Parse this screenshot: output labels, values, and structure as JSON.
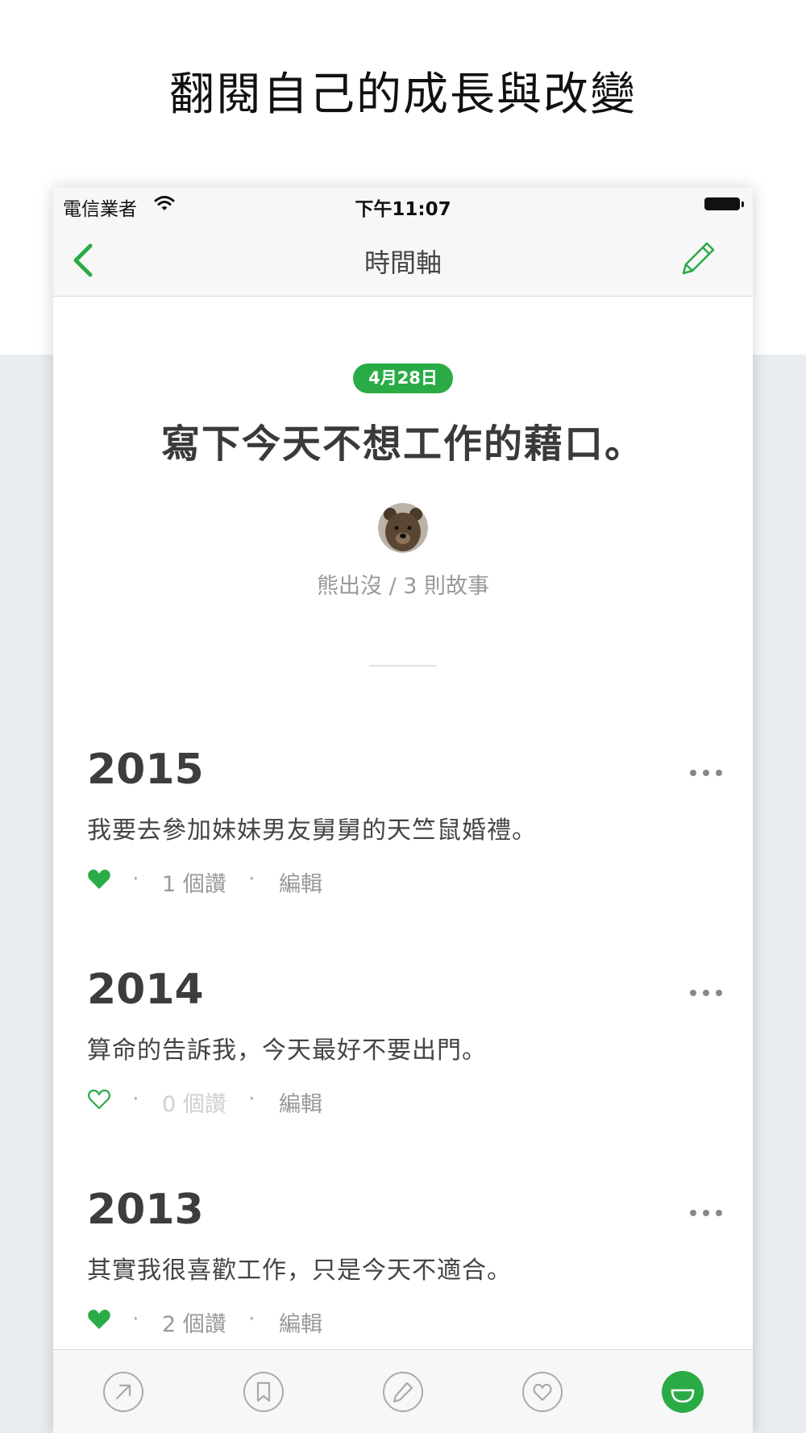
{
  "headline": "翻閱自己的成長與改變",
  "status_bar": {
    "carrier": "電信業者",
    "time": "下午11:07"
  },
  "nav": {
    "title": "時間軸",
    "back_icon": "chevron-left-icon",
    "compose_icon": "pencil-icon"
  },
  "question": {
    "date": "4月28日",
    "text": "寫下今天不想工作的藉口。",
    "author_line": "熊出沒 / 3 則故事"
  },
  "entries": [
    {
      "year": "2015",
      "text": "我要去參加妹妹男友舅舅的天竺鼠婚禮。",
      "liked": true,
      "likes": "1 個讚",
      "edit": "編輯"
    },
    {
      "year": "2014",
      "text": "算命的告訴我，今天最好不要出門。",
      "liked": false,
      "likes": "0 個讚",
      "edit": "編輯"
    },
    {
      "year": "2013",
      "text": "其實我很喜歡工作，只是今天不適合。",
      "liked": true,
      "likes": "2 個讚",
      "edit": "編輯"
    }
  ],
  "separator": "·",
  "tabbar": [
    {
      "icon": "share-arrow-icon",
      "active": false
    },
    {
      "icon": "bookmark-icon",
      "active": false
    },
    {
      "icon": "pencil-icon",
      "active": false
    },
    {
      "icon": "heart-icon",
      "active": false
    },
    {
      "icon": "smile-icon",
      "active": true
    }
  ],
  "colors": {
    "accent": "#2aab46",
    "text_dark": "#3a3a3a",
    "text_muted": "#999999",
    "background": "#e9edf2"
  }
}
